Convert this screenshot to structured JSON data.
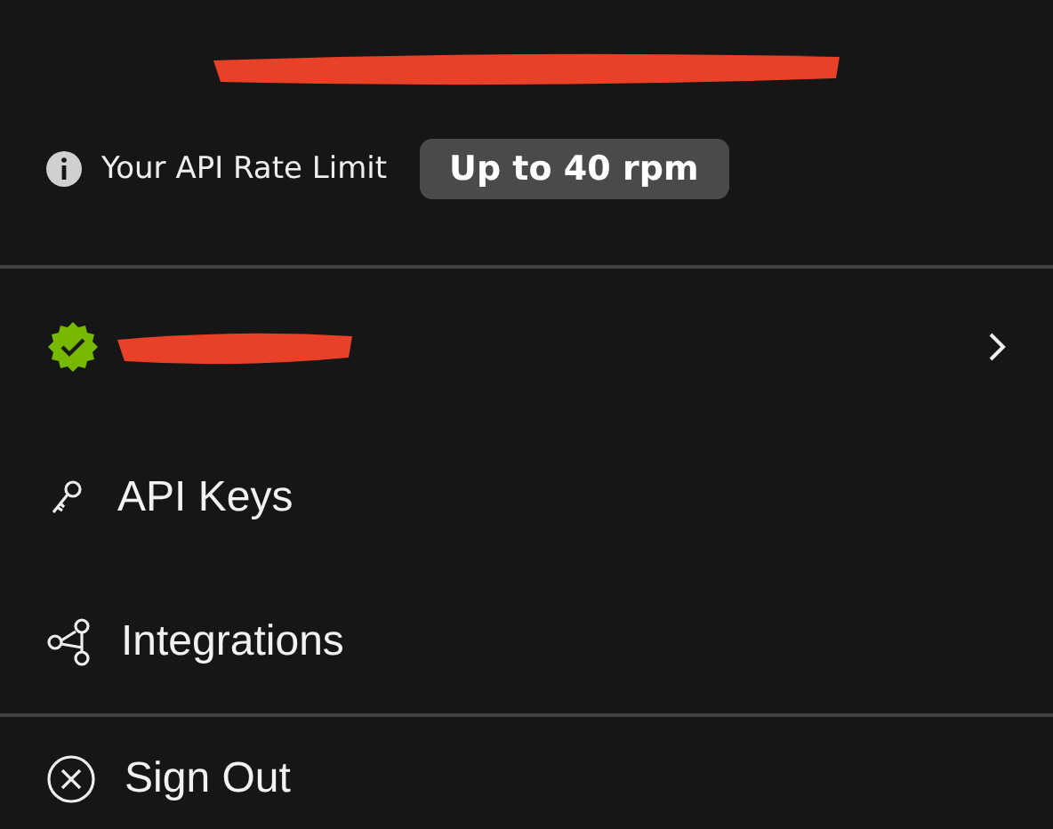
{
  "rate_limit": {
    "label": "Your API Rate Limit",
    "value": "Up to 40 rpm"
  },
  "account_row": {
    "verified": true
  },
  "menu": [
    {
      "label": "API Keys"
    },
    {
      "label": "Integrations"
    }
  ],
  "sign_out": {
    "label": "Sign Out"
  }
}
